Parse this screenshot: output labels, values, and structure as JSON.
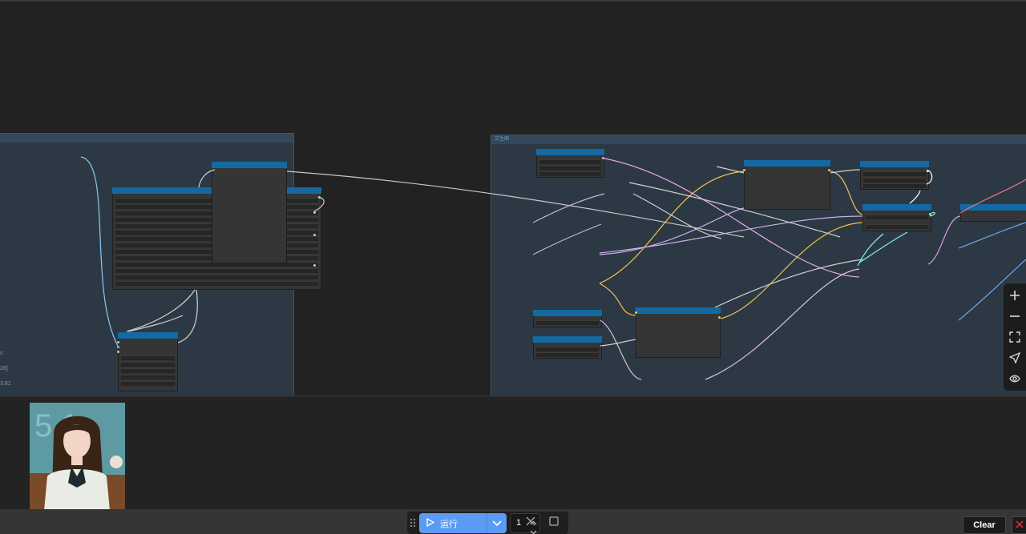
{
  "canvas": {
    "left_group": {
      "title": "",
      "side_values": [
        "s",
        "26]",
        "3.61"
      ]
    },
    "right_group": {
      "title": "文生图"
    }
  },
  "toolbar": {
    "run_label": "运行",
    "batch_count": "1"
  },
  "actions": {
    "clear_label": "Clear"
  },
  "gallery": {
    "thumbnail_text": "5 1"
  },
  "colors": {
    "canvas_bg": "#222222",
    "group_bg": "#2c3944",
    "node_title": "#1469a4",
    "run_button": "#5b9bf5",
    "close_icon": "#e03030"
  },
  "icons": {
    "drag": "drag-handle-icon",
    "run": "play-icon",
    "dropdown": "chevron-down-icon",
    "cancel": "close-icon",
    "stop": "square-icon",
    "zoom_in": "plus-icon",
    "zoom_out": "minus-icon",
    "fit": "fit-view-icon",
    "locate": "navigate-icon",
    "visibility": "eye-icon",
    "close_panel": "close-icon"
  }
}
